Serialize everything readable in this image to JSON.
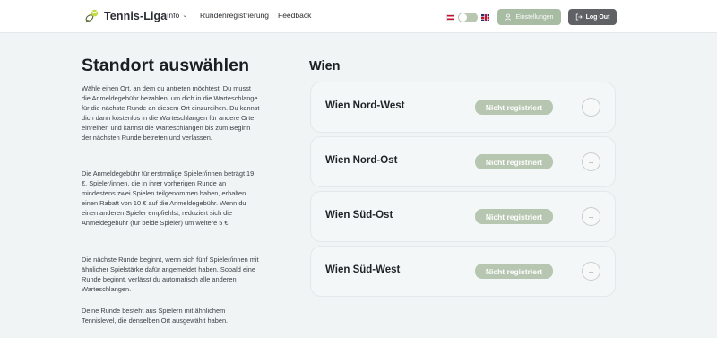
{
  "header": {
    "brand": "Tennis-Liga",
    "nav": {
      "info": "Info",
      "registration": "Rundenregistrierung",
      "feedback": "Feedback"
    },
    "settings_label": "Einstellungen",
    "logout_label": "Log Out"
  },
  "intro": {
    "title": "Standort auswählen",
    "paragraphs": [
      "Wähle einen Ort, an dem du antreten möchtest. Du musst die Anmeldegebühr bezahlen, um dich in die Warteschlange für die nächste Runde an diesem Ort einzureihen. Du kannst dich dann kostenlos in die Warteschlangen für andere Orte einreihen und kannst die Warteschlangen bis zum Beginn der nächsten Runde betreten und verlassen.",
      "Die Anmeldegebühr für erstmalige Spieler/innen beträgt 19 €. Spieler/innen, die in ihrer vorherigen Runde an mindestens zwei Spielen teilgenommen haben, erhalten einen Rabatt von 10 € auf die Anmeldegebühr. Wenn du einen anderen Spieler empfiehlst, reduziert sich die Anmeldegebühr (für beide Spieler) um weitere 5 €.",
      "Die nächste Runde beginnt, wenn sich fünf Spieler/innen mit ähnlicher Spielstärke dafür angemeldet haben. Sobald eine Runde beginnt, verlässt du automatisch alle anderen Warteschlangen.",
      "Deine Runde besteht aus Spielern mit ähnlichem Tennislevel, die denselben Ort ausgewählt haben."
    ]
  },
  "region": {
    "name": "Wien",
    "locations": [
      {
        "name": "Wien Nord-West",
        "status": "Nicht registriert"
      },
      {
        "name": "Wien Nord-Ost",
        "status": "Nicht registriert"
      },
      {
        "name": "Wien Süd-Ost",
        "status": "Nicht registriert"
      },
      {
        "name": "Wien Süd-West",
        "status": "Nicht registriert"
      }
    ]
  },
  "colors": {
    "accent": "#a8bba3",
    "status_badge": "#b7c6b0",
    "logout": "#5f6164",
    "background": "#f1f4f5"
  },
  "icons": {
    "logo": "tennis-ball-icon",
    "settings": "user-icon",
    "logout": "logout-icon",
    "card_action": "arrow-right-icon"
  }
}
